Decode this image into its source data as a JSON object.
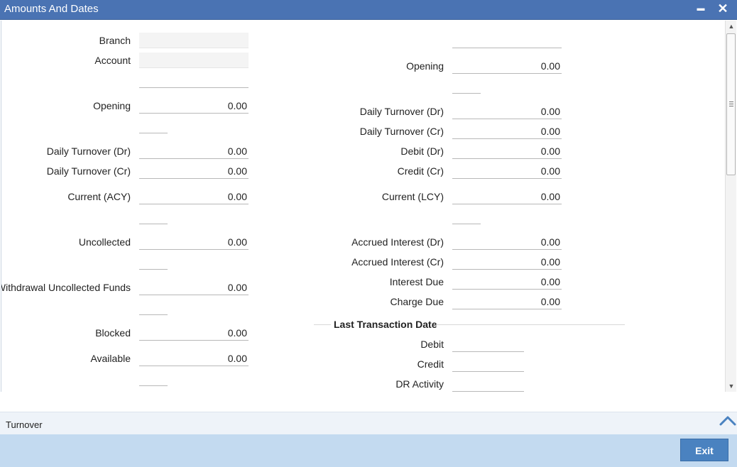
{
  "window": {
    "title": "Amounts And Dates",
    "minimize_symbol": "▬",
    "close_symbol": "✕"
  },
  "left": {
    "branch_label": "Branch",
    "branch_value": "",
    "account_label": "Account",
    "account_value": "",
    "opening_label": "Opening",
    "opening_value": "0.00",
    "daily_dr_label": "Daily Turnover (Dr)",
    "daily_dr_value": "0.00",
    "daily_cr_label": "Daily Turnover (Cr)",
    "daily_cr_value": "0.00",
    "current_acy_label": "Current (ACY)",
    "current_acy_value": "0.00",
    "uncollected_label": "Uncollected",
    "uncollected_value": "0.00",
    "withdrawal_label": "Withdrawal Uncollected Funds",
    "withdrawal_value": "0.00",
    "blocked_label": "Blocked",
    "blocked_value": "0.00",
    "available_label": "Available",
    "available_value": "0.00"
  },
  "right": {
    "opening_label": "Opening",
    "opening_value": "0.00",
    "daily_dr_label": "Daily Turnover (Dr)",
    "daily_dr_value": "0.00",
    "daily_cr_label": "Daily Turnover (Cr)",
    "daily_cr_value": "0.00",
    "debit_label": "Debit (Dr)",
    "debit_value": "0.00",
    "credit_label": "Credit (Cr)",
    "credit_value": "0.00",
    "current_lcy_label": "Current (LCY)",
    "current_lcy_value": "0.00",
    "accrued_dr_label": "Accrued Interest (Dr)",
    "accrued_dr_value": "0.00",
    "accrued_cr_label": "Accrued Interest (Cr)",
    "accrued_cr_value": "0.00",
    "interest_due_label": "Interest Due",
    "interest_due_value": "0.00",
    "charge_due_label": "Charge Due",
    "charge_due_value": "0.00"
  },
  "last_txn": {
    "header": "Last Transaction Date",
    "debit_label": "Debit",
    "debit_value": "",
    "credit_label": "Credit",
    "credit_value": "",
    "dr_activity_label": "DR Activity",
    "dr_activity_value": ""
  },
  "turnover": {
    "label": "Turnover"
  },
  "footer": {
    "exit_label": "Exit"
  },
  "colors": {
    "titlebar": "#4a73b3",
    "footer": "#c3daf0",
    "exit_button": "#4a82c0",
    "turnover_bar": "#eef3f9"
  },
  "icons": {
    "chevron": "chevron-up-icon",
    "scroll_up": "scroll-up-arrow-icon",
    "scroll_down": "scroll-down-arrow-icon"
  }
}
